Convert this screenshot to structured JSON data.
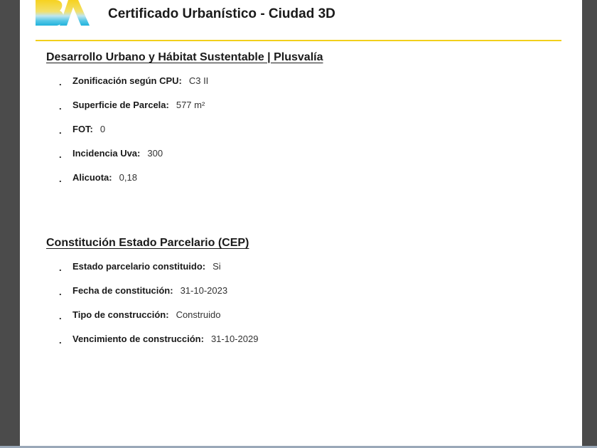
{
  "header": {
    "title": "Certificado Urbanístico - Ciudad 3D",
    "logo_text": "BA",
    "accent_color": "#f2cf1b"
  },
  "sections": [
    {
      "title": "Desarrollo Urbano y Hábitat Sustentable | Plusvalía",
      "items": [
        {
          "bullet": ".",
          "label": "Zonificación según CPU:",
          "value": "C3 II"
        },
        {
          "bullet": ".",
          "label": "Superficie de Parcela:",
          "value": "577 m²"
        },
        {
          "bullet": ".",
          "label": "FOT:",
          "value": "0"
        },
        {
          "bullet": ".",
          "label": "Incidencia Uva:",
          "value": "300"
        },
        {
          "bullet": ".",
          "label": "Alicuota:",
          "value": "0,18"
        }
      ]
    },
    {
      "title": "Constitución Estado Parcelario (CEP)",
      "items": [
        {
          "bullet": ".",
          "label": "Estado parcelario constituido:",
          "value": "Si"
        },
        {
          "bullet": ".",
          "label": "Fecha de constitución:",
          "value": "31-10-2023"
        },
        {
          "bullet": ".",
          "label": "Tipo de construcción:",
          "value": "Construido"
        },
        {
          "bullet": ".",
          "label": "Vencimiento de construcción:",
          "value": "31-10-2029"
        }
      ]
    }
  ]
}
